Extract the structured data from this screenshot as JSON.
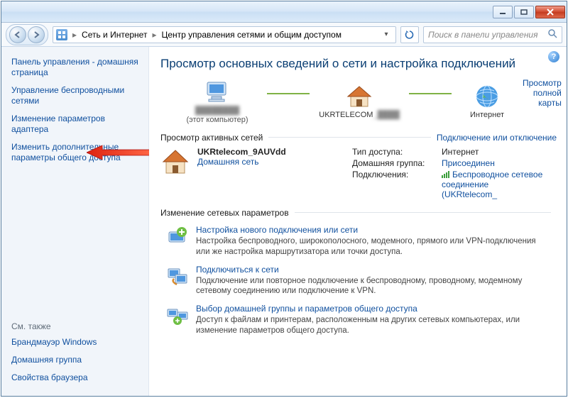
{
  "breadcrumb": {
    "part1": "Сеть и Интернет",
    "part2": "Центр управления сетями и общим доступом"
  },
  "search": {
    "placeholder": "Поиск в панели управления"
  },
  "sidebar": {
    "items": [
      "Панель управления - домашняя страница",
      "Управление беспроводными сетями",
      "Изменение параметров адаптера",
      "Изменить дополнительные параметры общего доступа"
    ],
    "see_also_heading": "См. также",
    "see_also": [
      "Брандмауэр Windows",
      "Домашняя группа",
      "Свойства браузера"
    ]
  },
  "page_title": "Просмотр основных сведений о сети и настройка подключений",
  "map": {
    "node1_sub": "(этот компьютер)",
    "node2": "UKRTELECOM",
    "node3": "Интернет",
    "full_map_link": "Просмотр полной карты"
  },
  "active": {
    "heading": "Просмотр активных сетей",
    "right_link": "Подключение или отключение",
    "net_name": "UKRtelecom_9AUVdd",
    "net_type": "Домашняя сеть",
    "kv": {
      "k1": "Тип доступа:",
      "v1": "Интернет",
      "k2": "Домашняя группа:",
      "v2": "Присоединен",
      "k3": "Подключения:",
      "v3a": "Беспроводное сетевое соединение",
      "v3b": "(UKRtelecom_"
    }
  },
  "change": {
    "heading": "Изменение сетевых параметров",
    "tasks": [
      {
        "title": "Настройка нового подключения или сети",
        "desc": "Настройка беспроводного, широкополосного, модемного, прямого или VPN-подключения или же настройка маршрутизатора или точки доступа."
      },
      {
        "title": "Подключиться к сети",
        "desc": "Подключение или повторное подключение к беспроводному, проводному, модемному сетевому соединению или подключение к VPN."
      },
      {
        "title": "Выбор домашней группы и параметров общего доступа",
        "desc": "Доступ к файлам и принтерам, расположенным на других сетевых компьютерах, или изменение параметров общего доступа."
      }
    ]
  }
}
